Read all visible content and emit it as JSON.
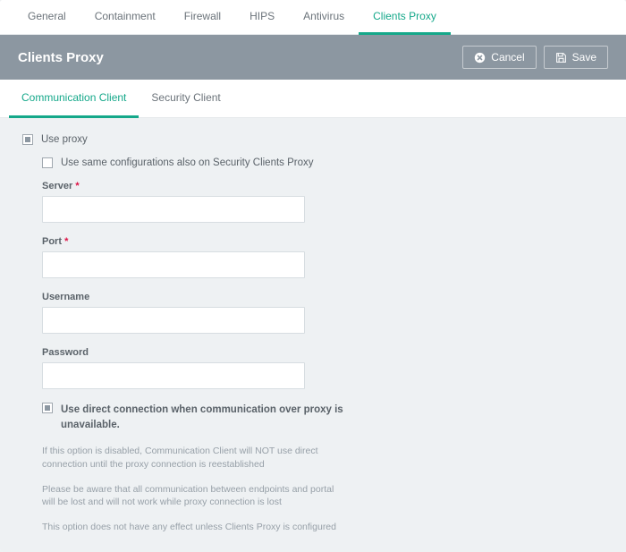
{
  "topTabs": {
    "general": "General",
    "containment": "Containment",
    "firewall": "Firewall",
    "hips": "HIPS",
    "antivirus": "Antivirus",
    "clientsProxy": "Clients Proxy"
  },
  "panel": {
    "title": "Clients Proxy",
    "cancel": "Cancel",
    "save": "Save"
  },
  "subTabs": {
    "communicationClient": "Communication Client",
    "securityClient": "Security Client"
  },
  "form": {
    "useProxy": "Use proxy",
    "useSameConfig": "Use same configurations also on Security Clients Proxy",
    "serverLabel": "Server",
    "serverValue": "",
    "portLabel": "Port",
    "portValue": "",
    "usernameLabel": "Username",
    "usernameValue": "",
    "passwordLabel": "Password",
    "passwordValue": "",
    "directConnection": "Use direct connection when communication over proxy is unavailable.",
    "note1": "If this option is disabled, Communication Client will NOT use direct connection until the proxy connection is reestablished",
    "note2": "Please be aware that all communication between endpoints and portal will be lost and will not work while proxy connection is lost",
    "note3": "This option does not have any effect unless Clients Proxy is configured",
    "required": "*"
  }
}
